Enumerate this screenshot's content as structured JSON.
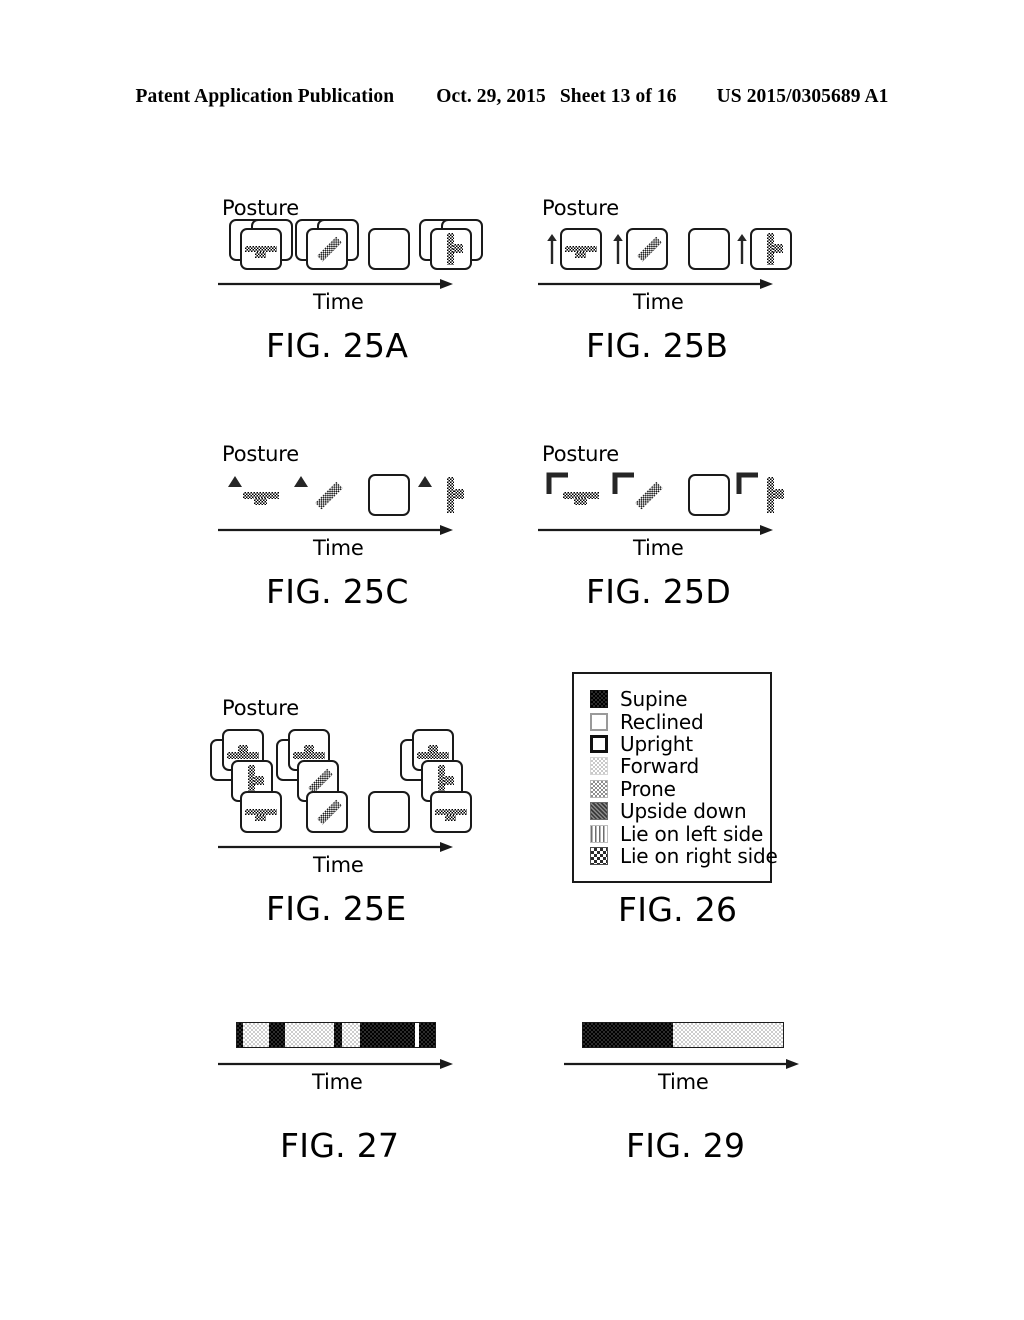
{
  "header": {
    "publication": "Patent Application Publication",
    "date": "Oct. 29, 2015",
    "sheet": "Sheet 13 of 16",
    "patent_number": "US 2015/0305689 A1"
  },
  "axis_labels": {
    "posture": "Posture",
    "time": "Time"
  },
  "figures": [
    {
      "id": "fig-25a",
      "caption": "FIG. 25A",
      "posture_label": "Posture",
      "time_label": "Time",
      "variant": "stacked-cards",
      "slots": [
        {
          "posture": "supine",
          "stack": 2,
          "empty": false,
          "marker": "none"
        },
        {
          "posture": "diagonal",
          "stack": 2,
          "empty": false,
          "marker": "none"
        },
        {
          "posture": "upright",
          "stack": 1,
          "empty": true,
          "marker": "none"
        },
        {
          "posture": "standing",
          "stack": 2,
          "empty": false,
          "marker": "none"
        }
      ]
    },
    {
      "id": "fig-25b",
      "caption": "FIG. 25B",
      "posture_label": "Posture",
      "time_label": "Time",
      "variant": "single-card-arrow",
      "slots": [
        {
          "posture": "supine",
          "stack": 1,
          "empty": false,
          "marker": "arrow-up"
        },
        {
          "posture": "diagonal",
          "stack": 1,
          "empty": false,
          "marker": "arrow-up"
        },
        {
          "posture": "upright",
          "stack": 1,
          "empty": true,
          "marker": "none"
        },
        {
          "posture": "standing",
          "stack": 1,
          "empty": false,
          "marker": "arrow-up"
        }
      ]
    },
    {
      "id": "fig-25c",
      "caption": "FIG. 25C",
      "posture_label": "Posture",
      "time_label": "Time",
      "variant": "borderless-triangle",
      "slots": [
        {
          "posture": "supine",
          "stack": 0,
          "empty": false,
          "marker": "triangle-up"
        },
        {
          "posture": "diagonal",
          "stack": 0,
          "empty": false,
          "marker": "triangle-up"
        },
        {
          "posture": "upright",
          "stack": 1,
          "empty": true,
          "marker": "none"
        },
        {
          "posture": "standing",
          "stack": 0,
          "empty": false,
          "marker": "triangle-up"
        }
      ]
    },
    {
      "id": "fig-25d",
      "caption": "FIG. 25D",
      "posture_label": "Posture",
      "time_label": "Time",
      "variant": "borderless-bracket",
      "slots": [
        {
          "posture": "supine",
          "stack": 0,
          "empty": false,
          "marker": "corner-bracket"
        },
        {
          "posture": "diagonal",
          "stack": 0,
          "empty": false,
          "marker": "corner-bracket"
        },
        {
          "posture": "upright",
          "stack": 1,
          "empty": true,
          "marker": "none"
        },
        {
          "posture": "standing",
          "stack": 0,
          "empty": false,
          "marker": "corner-bracket"
        }
      ]
    },
    {
      "id": "fig-25e",
      "caption": "FIG. 25E",
      "posture_label": "Posture",
      "time_label": "Time",
      "variant": "vertical-stack",
      "slots": [
        {
          "posture": "supine",
          "stack": 3,
          "empty": false,
          "marker": "none"
        },
        {
          "posture": "diagonal",
          "stack": 3,
          "empty": false,
          "marker": "none"
        },
        {
          "posture": "upright",
          "stack": 1,
          "empty": true,
          "marker": "none"
        },
        {
          "posture": "standing",
          "stack": 3,
          "empty": false,
          "marker": "none"
        }
      ]
    }
  ],
  "legend": {
    "caption": "FIG. 26",
    "entries": [
      {
        "label": "Supine",
        "swatch": "supine"
      },
      {
        "label": "Reclined",
        "swatch": "reclined"
      },
      {
        "label": "Upright",
        "swatch": "upright"
      },
      {
        "label": "Forward",
        "swatch": "forward"
      },
      {
        "label": "Prone",
        "swatch": "prone"
      },
      {
        "label": "Upside down",
        "swatch": "upsidedown"
      },
      {
        "label": "Lie on left side",
        "swatch": "leftside"
      },
      {
        "label": "Lie on right side",
        "swatch": "rightside"
      }
    ]
  },
  "timelines": [
    {
      "id": "fig-27",
      "caption": "FIG. 27",
      "time_label": "Time",
      "segments": [
        {
          "fill": "dark",
          "width_pct": 3
        },
        {
          "fill": "light",
          "width_pct": 13
        },
        {
          "fill": "dark",
          "width_pct": 8
        },
        {
          "fill": "light",
          "width_pct": 25
        },
        {
          "fill": "dark",
          "width_pct": 4
        },
        {
          "fill": "light",
          "width_pct": 9
        },
        {
          "fill": "dark",
          "width_pct": 28
        },
        {
          "fill": "white",
          "width_pct": 2
        },
        {
          "fill": "dark",
          "width_pct": 8
        }
      ]
    },
    {
      "id": "fig-29",
      "caption": "FIG. 29",
      "time_label": "Time",
      "segments": [
        {
          "fill": "dark",
          "width_pct": 45
        },
        {
          "fill": "light",
          "width_pct": 55
        }
      ]
    }
  ]
}
